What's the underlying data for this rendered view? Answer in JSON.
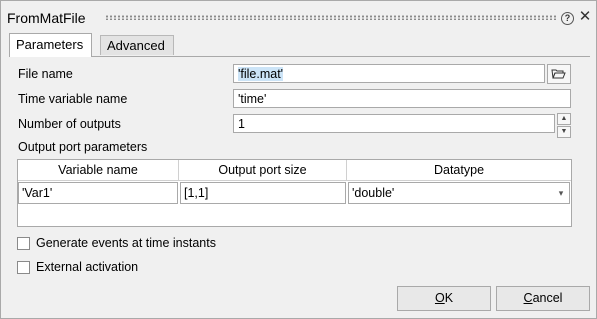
{
  "window": {
    "title": "FromMatFile",
    "help_glyph": "?",
    "close_glyph": "✕"
  },
  "tabs": [
    {
      "label": "Parameters",
      "active": true
    },
    {
      "label": "Advanced",
      "active": false
    }
  ],
  "fields": {
    "file_name": {
      "label": "File name",
      "value": "'file.mat'"
    },
    "time_variable": {
      "label": "Time variable name",
      "value": "'time'"
    },
    "num_outputs": {
      "label": "Number of outputs",
      "value": "1"
    }
  },
  "output_port": {
    "section_label": "Output port parameters",
    "columns": [
      "Variable name",
      "Output port size",
      "Datatype"
    ],
    "rows": [
      {
        "variable": "'Var1'",
        "size": "[1,1]",
        "datatype": "'double'"
      }
    ]
  },
  "checkboxes": {
    "generate_events": {
      "label": "Generate events at time instants",
      "checked": false
    },
    "external_activation": {
      "label": "External activation",
      "checked": false
    }
  },
  "buttons": {
    "ok": {
      "mnemonic": "O",
      "rest": "K"
    },
    "cancel": {
      "mnemonic": "C",
      "rest": "ancel"
    }
  },
  "icons": {
    "folder": "folder-open-icon",
    "help": "help-icon",
    "close": "close-icon",
    "dropdown": "chevron-down-icon"
  }
}
